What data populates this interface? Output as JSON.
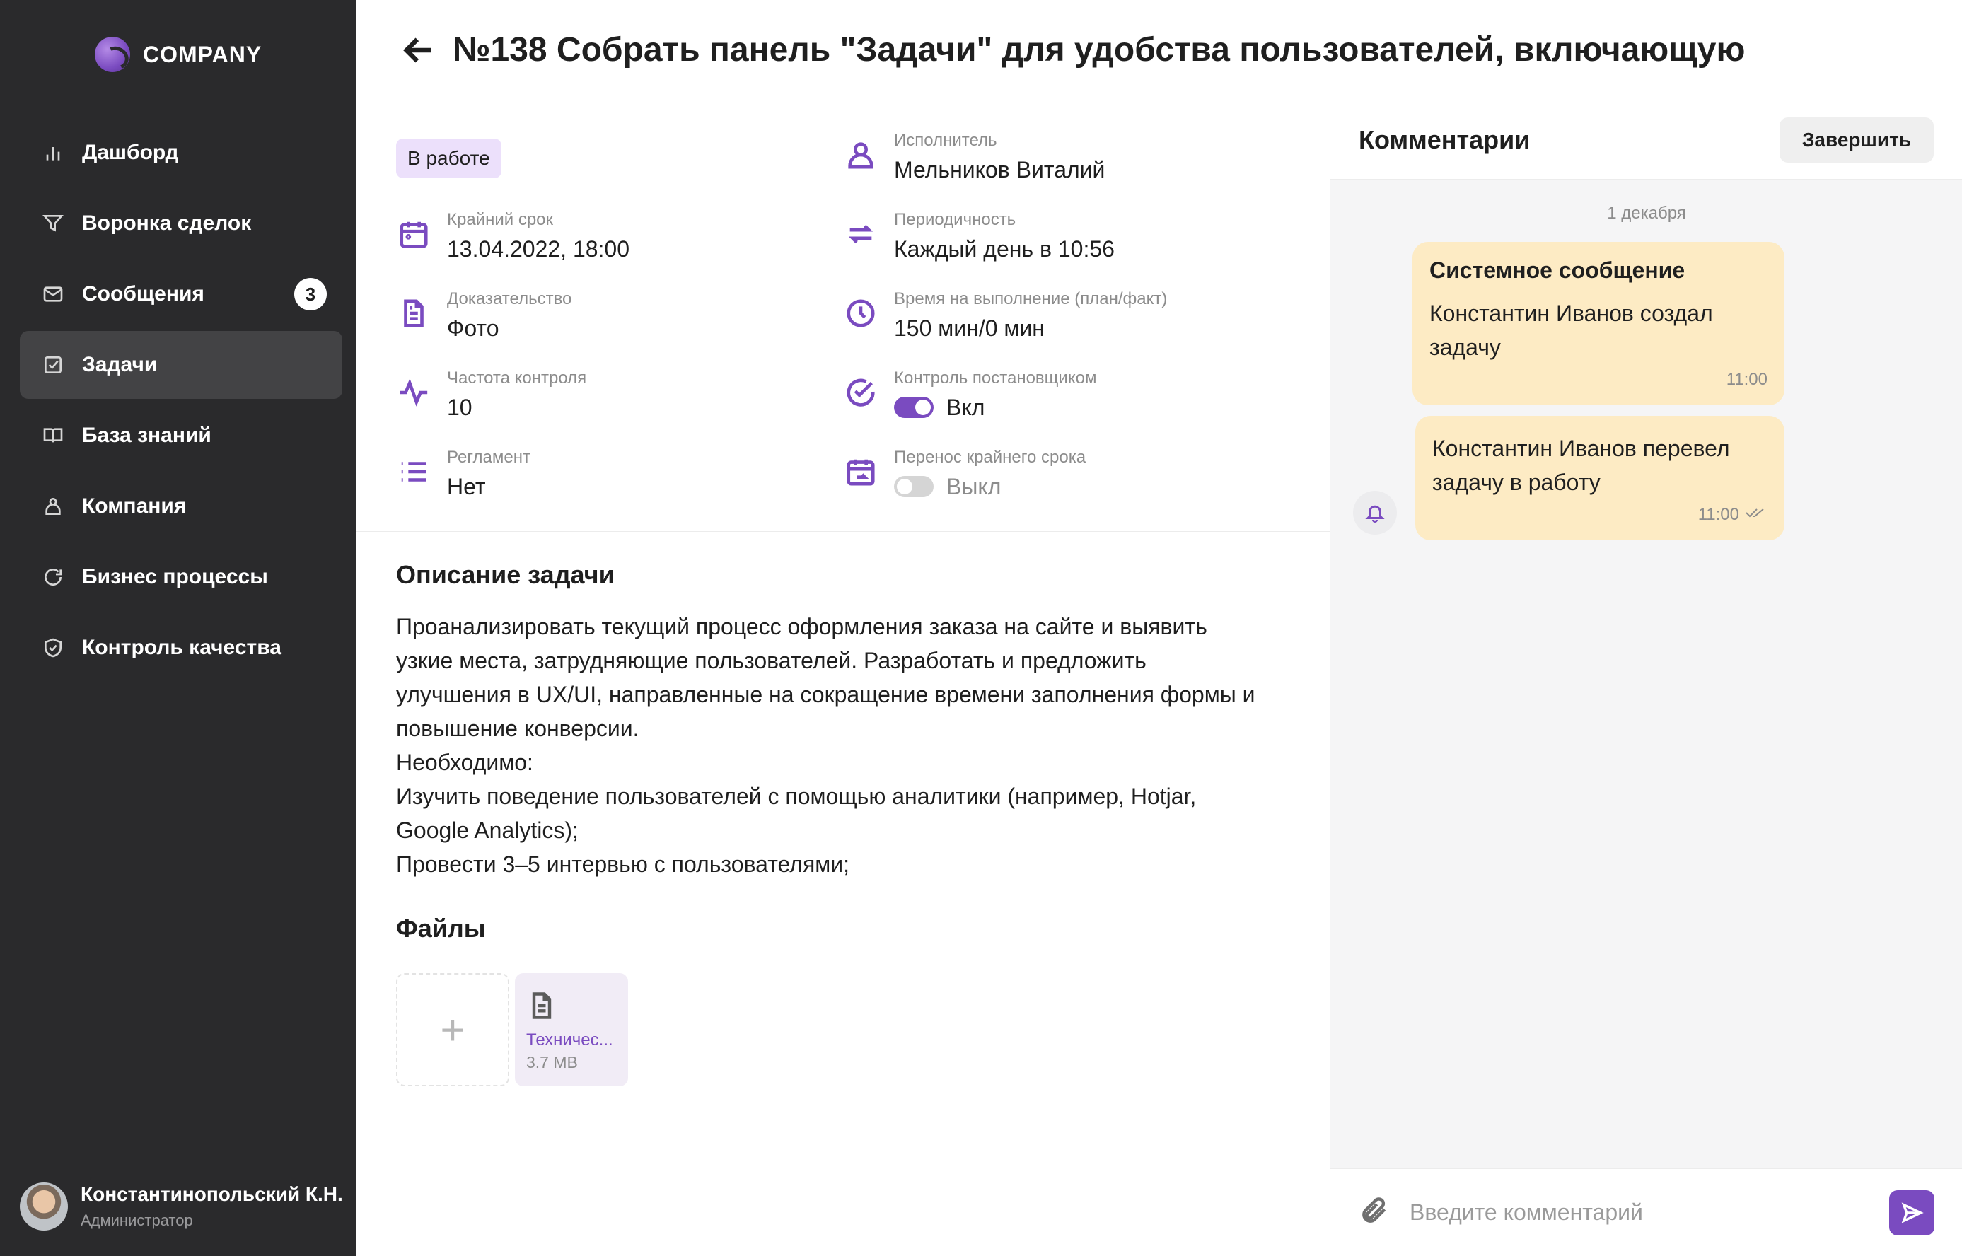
{
  "brand": {
    "name": "COMPANY"
  },
  "sidebar": {
    "items": [
      {
        "label": "Дашборд",
        "icon": "bar-chart-icon",
        "active": false
      },
      {
        "label": "Воронка сделок",
        "icon": "funnel-icon",
        "active": false
      },
      {
        "label": "Сообщения",
        "icon": "mail-icon",
        "active": false,
        "badge": "3"
      },
      {
        "label": "Задачи",
        "icon": "checkbox-icon",
        "active": true
      },
      {
        "label": "База знаний",
        "icon": "book-icon",
        "active": false
      },
      {
        "label": "Компания",
        "icon": "org-icon",
        "active": false
      },
      {
        "label": "Бизнес процессы",
        "icon": "refresh-icon",
        "active": false
      },
      {
        "label": "Контроль качества",
        "icon": "shield-check-icon",
        "active": false
      }
    ],
    "user": {
      "name": "Константинопольский К.Н.",
      "role": "Администратор"
    }
  },
  "header": {
    "title": "№138 Собрать панель \"Задачи\" для удобства пользователей, включающую"
  },
  "task": {
    "status": "В работе",
    "fields_left": [
      {
        "label": "Крайний срок",
        "value": "13.04.2022, 18:00",
        "icon": "calendar-icon"
      },
      {
        "label": "Доказательство",
        "value": "Фото",
        "icon": "document-icon"
      },
      {
        "label": "Частота контроля",
        "value": "10",
        "icon": "activity-icon"
      },
      {
        "label": "Регламент",
        "value": "Нет",
        "icon": "list-icon"
      }
    ],
    "fields_right": [
      {
        "label": "Исполнитель",
        "value": "Мельников Виталий",
        "icon": "user-icon"
      },
      {
        "label": "Периодичность",
        "value": "Каждый день в 10:56",
        "icon": "repeat-icon"
      },
      {
        "label": "Время на выполнение (план/факт)",
        "value": "150 мин/0 мин",
        "icon": "clock-icon"
      },
      {
        "label": "Контроль постановщиком",
        "value": "Вкл",
        "icon": "check-circle-icon",
        "toggle": true
      },
      {
        "label": "Перенос крайнего срока",
        "value": "Выкл",
        "icon": "calendar-move-icon",
        "toggle": false
      }
    ],
    "description_title": "Описание задачи",
    "description": "Проанализировать текущий процесс оформления заказа на сайте и выявить\nузкие места, затрудняющие пользователей. Разработать и предложить\nулучшения в UX/UI, направленные на сокращение времени заполнения формы и\nповышение конверсии.\nНеобходимо:\nИзучить поведение пользователей с помощью аналитики (например, Hotjar,\nGoogle Analytics);\nПровести 3–5 интервью с пользователями;",
    "files_title": "Файлы",
    "files": [
      {
        "name": "Техничес...",
        "size": "3.7 MB"
      }
    ]
  },
  "comments": {
    "title": "Комментарии",
    "finish_label": "Завершить",
    "date": "1 декабря",
    "messages": [
      {
        "title": "Системное сообщение",
        "text": "Константин Иванов создал\nзадачу",
        "time": "11:00"
      },
      {
        "text": "Константин Иванов перевел\nзадачу в работу",
        "time": "11:00"
      }
    ],
    "input_placeholder": "Введите комментарий"
  },
  "colors": {
    "accent": "#7a4bc0",
    "sidebar_bg": "#2a2a2c",
    "status_bg": "#ece0fb",
    "bubble_bg": "#fdebc4"
  }
}
